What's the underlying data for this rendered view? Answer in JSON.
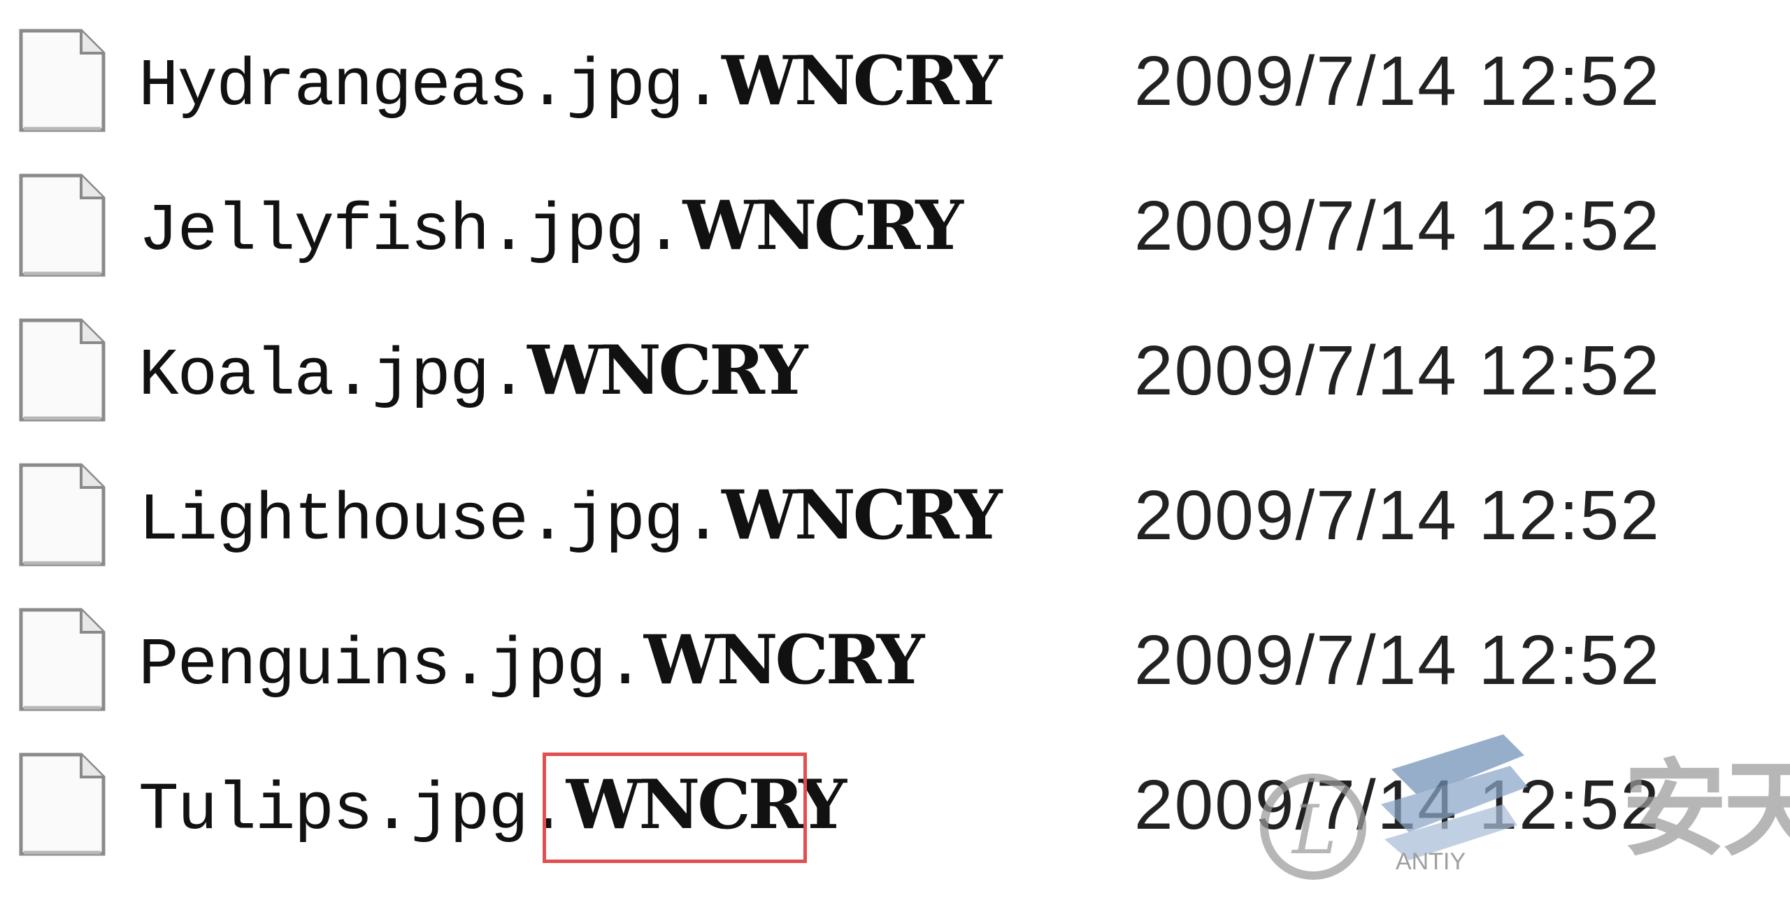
{
  "files": [
    {
      "name": "Hydrangeas.jpg.",
      "ext": "WNCRY",
      "date": "2009/7/14 12:52",
      "icon": "blank-file-icon"
    },
    {
      "name": "Jellyfish.jpg.",
      "ext": "WNCRY",
      "date": "2009/7/14 12:52",
      "icon": "blank-file-icon"
    },
    {
      "name": "Koala.jpg.",
      "ext": "WNCRY",
      "date": "2009/7/14 12:52",
      "icon": "blank-file-icon"
    },
    {
      "name": "Lighthouse.jpg.",
      "ext": "WNCRY",
      "date": "2009/7/14 12:52",
      "icon": "blank-file-icon"
    },
    {
      "name": "Penguins.jpg.",
      "ext": "WNCRY",
      "date": "2009/7/14 12:52",
      "icon": "blank-file-icon"
    },
    {
      "name": "Tulips.jpg.",
      "ext": "WNCRY",
      "date": "2009/7/14 12:52",
      "icon": "blank-file-icon"
    }
  ],
  "highlight": {
    "color": "#e05050",
    "target": "files.5.ext"
  },
  "watermark": {
    "brand": "安天",
    "sub": "ANTIY",
    "logo_icon": "antiy-logo-icon"
  }
}
